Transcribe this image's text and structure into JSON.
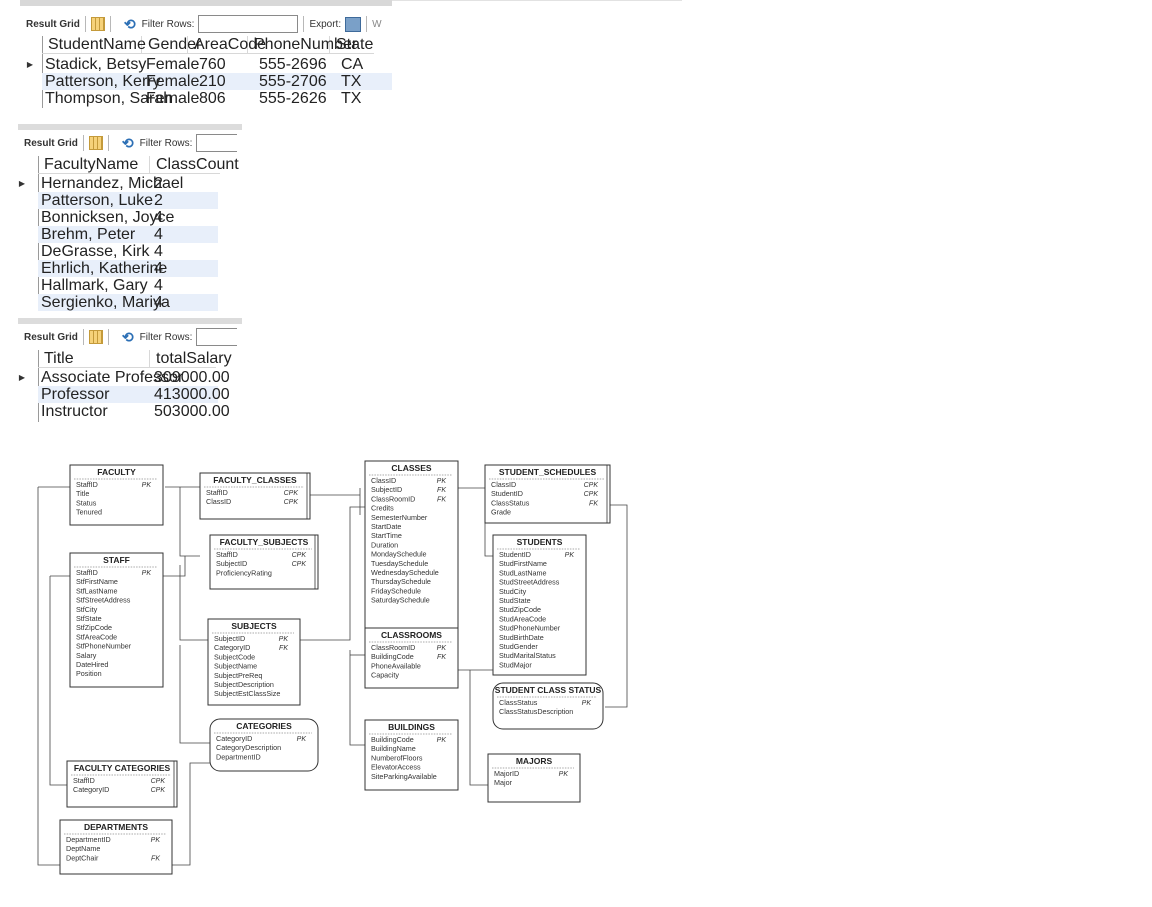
{
  "grids": [
    {
      "toolbar": {
        "result_grid": "Result Grid",
        "filter_rows": "Filter Rows:",
        "export": "Export:",
        "trailing": "W"
      },
      "columns": [
        "StudentName",
        "Gender",
        "AreaCode",
        "PhoneNumber",
        "State"
      ],
      "rows": [
        [
          "Stadick, Betsy",
          "Female",
          "760",
          "555-2696",
          "CA"
        ],
        [
          "Patterson, Kerry",
          "Female",
          "210",
          "555-2706",
          "TX"
        ],
        [
          "Thompson, Sarah",
          "Female",
          "806",
          "555-2626",
          "TX"
        ]
      ]
    },
    {
      "toolbar": {
        "result_grid": "Result Grid",
        "filter_rows": "Filter Rows:"
      },
      "columns": [
        "FacultyName",
        "ClassCount"
      ],
      "rows": [
        [
          "Hernandez, Michael",
          "2"
        ],
        [
          "Patterson, Luke",
          "2"
        ],
        [
          "Bonnicksen, Joyce",
          "4"
        ],
        [
          "Brehm, Peter",
          "4"
        ],
        [
          "DeGrasse, Kirk",
          "4"
        ],
        [
          "Ehrlich, Katherine",
          "4"
        ],
        [
          "Hallmark, Gary",
          "4"
        ],
        [
          "Sergienko, Mariya",
          "4"
        ]
      ]
    },
    {
      "toolbar": {
        "result_grid": "Result Grid",
        "filter_rows": "Filter Rows:"
      },
      "columns": [
        "Title",
        "totalSalary"
      ],
      "rows": [
        [
          "Associate Professor",
          "309000.00"
        ],
        [
          "Professor",
          "413000.00"
        ],
        [
          "Instructor",
          "503000.00"
        ]
      ]
    }
  ],
  "erd": {
    "entities": {
      "faculty": {
        "title": "FACULTY",
        "fields": [
          [
            "StaffID",
            "PK"
          ],
          [
            "Title",
            ""
          ],
          [
            "Status",
            ""
          ],
          [
            "Tenured",
            ""
          ]
        ]
      },
      "faculty_classes": {
        "title": "FACULTY_CLASSES",
        "fields": [
          [
            "StaffID",
            "CPK"
          ],
          [
            "ClassID",
            "CPK"
          ]
        ]
      },
      "classes": {
        "title": "CLASSES",
        "fields": [
          [
            "ClassID",
            "PK"
          ],
          [
            "SubjectID",
            "FK"
          ],
          [
            "ClassRoomID",
            "FK"
          ],
          [
            "Credits",
            ""
          ],
          [
            "SemesterNumber",
            ""
          ],
          [
            "StartDate",
            ""
          ],
          [
            "StartTime",
            ""
          ],
          [
            "Duration",
            ""
          ],
          [
            "MondaySchedule",
            ""
          ],
          [
            "TuesdaySchedule",
            ""
          ],
          [
            "WednesdaySchedule",
            ""
          ],
          [
            "ThursdaySchedule",
            ""
          ],
          [
            "FridaySchedule",
            ""
          ],
          [
            "SaturdaySchedule",
            ""
          ]
        ]
      },
      "student_schedules": {
        "title": "STUDENT_SCHEDULES",
        "fields": [
          [
            "ClassID",
            "CPK"
          ],
          [
            "StudentID",
            "CPK"
          ],
          [
            "ClassStatus",
            "FK"
          ],
          [
            "Grade",
            ""
          ]
        ]
      },
      "faculty_subjects": {
        "title": "FACULTY_SUBJECTS",
        "fields": [
          [
            "StaffID",
            "CPK"
          ],
          [
            "SubjectID",
            "CPK"
          ],
          [
            "ProficiencyRating",
            ""
          ]
        ]
      },
      "staff": {
        "title": "STAFF",
        "fields": [
          [
            "StaffID",
            "PK"
          ],
          [
            "StfFirstName",
            ""
          ],
          [
            "StfLastName",
            ""
          ],
          [
            "StfStreetAddress",
            ""
          ],
          [
            "StfCity",
            ""
          ],
          [
            "StfState",
            ""
          ],
          [
            "StfZipCode",
            ""
          ],
          [
            "StfAreaCode",
            ""
          ],
          [
            "StfPhoneNumber",
            ""
          ],
          [
            "Salary",
            ""
          ],
          [
            "DateHired",
            ""
          ],
          [
            "Position",
            ""
          ]
        ]
      },
      "students": {
        "title": "STUDENTS",
        "fields": [
          [
            "StudentID",
            "PK"
          ],
          [
            "StudFirstName",
            ""
          ],
          [
            "StudLastName",
            ""
          ],
          [
            "StudStreetAddress",
            ""
          ],
          [
            "StudCity",
            ""
          ],
          [
            "StudState",
            ""
          ],
          [
            "StudZipCode",
            ""
          ],
          [
            "StudAreaCode",
            ""
          ],
          [
            "StudPhoneNumber",
            ""
          ],
          [
            "StudBirthDate",
            ""
          ],
          [
            "StudGender",
            ""
          ],
          [
            "StudMaritalStatus",
            ""
          ],
          [
            "StudMajor",
            ""
          ]
        ]
      },
      "subjects": {
        "title": "SUBJECTS",
        "fields": [
          [
            "SubjectID",
            "PK"
          ],
          [
            "CategoryID",
            "FK"
          ],
          [
            "SubjectCode",
            ""
          ],
          [
            "SubjectName",
            ""
          ],
          [
            "SubjectPreReq",
            ""
          ],
          [
            "SubjectDescription",
            ""
          ],
          [
            "SubjectEstClassSize",
            ""
          ]
        ]
      },
      "classrooms": {
        "title": "CLASSROOMS",
        "fields": [
          [
            "ClassRoomID",
            "PK"
          ],
          [
            "BuildingCode",
            "FK"
          ],
          [
            "PhoneAvailable",
            ""
          ],
          [
            "Capacity",
            ""
          ]
        ]
      },
      "student_class_status": {
        "title": "STUDENT CLASS STATUS",
        "fields": [
          [
            "ClassStatus",
            "PK"
          ],
          [
            "ClassStatusDescription",
            ""
          ]
        ]
      },
      "categories": {
        "title": "CATEGORIES",
        "fields": [
          [
            "CategoryID",
            "PK"
          ],
          [
            "CategoryDescription",
            ""
          ],
          [
            "DepartmentID",
            ""
          ]
        ]
      },
      "buildings": {
        "title": "BUILDINGS",
        "fields": [
          [
            "BuildingCode",
            "PK"
          ],
          [
            "BuildingName",
            ""
          ],
          [
            "NumberofFloors",
            ""
          ],
          [
            "ElevatorAccess",
            ""
          ],
          [
            "SiteParkingAvailable",
            ""
          ]
        ]
      },
      "majors": {
        "title": "MAJORS",
        "fields": [
          [
            "MajorID",
            "PK"
          ],
          [
            "Major",
            ""
          ]
        ]
      },
      "faculty_categories": {
        "title": "FACULTY CATEGORIES",
        "fields": [
          [
            "StaffID",
            "CPK"
          ],
          [
            "CategoryID",
            "CPK"
          ]
        ]
      },
      "departments": {
        "title": "DEPARTMENTS",
        "fields": [
          [
            "DepartmentID",
            "PK"
          ],
          [
            "DeptName",
            ""
          ],
          [
            "DeptChair",
            "FK"
          ]
        ]
      }
    }
  }
}
